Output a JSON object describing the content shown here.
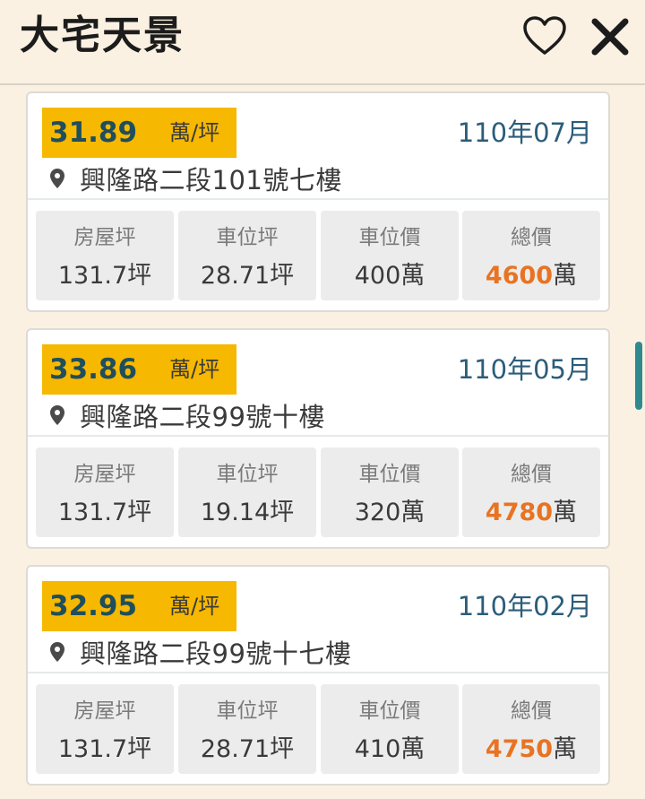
{
  "header": {
    "title": "大宅天景",
    "favorite_icon": "heart-outline-icon",
    "close_icon": "close-icon"
  },
  "colors": {
    "background": "#fbf1e2",
    "price_tag": "#f6b800",
    "price_text": "#1f4e5c",
    "date_text": "#2b5d7a",
    "total_price": "#e87322",
    "scrollbar": "#2f8a8f"
  },
  "transactions": [
    {
      "unit_price": "31.89",
      "unit_price_unit": "萬/坪",
      "date": "110年07月",
      "address": "興隆路二段101號七樓",
      "stats": [
        {
          "label": "房屋坪",
          "value": "131.7",
          "unit": "坪"
        },
        {
          "label": "車位坪",
          "value": "28.71",
          "unit": "坪"
        },
        {
          "label": "車位價",
          "value": "400",
          "unit": "萬"
        },
        {
          "label": "總價",
          "value": "4600",
          "unit": "萬"
        }
      ]
    },
    {
      "unit_price": "33.86",
      "unit_price_unit": "萬/坪",
      "date": "110年05月",
      "address": "興隆路二段99號十樓",
      "stats": [
        {
          "label": "房屋坪",
          "value": "131.7",
          "unit": "坪"
        },
        {
          "label": "車位坪",
          "value": "19.14",
          "unit": "坪"
        },
        {
          "label": "車位價",
          "value": "320",
          "unit": "萬"
        },
        {
          "label": "總價",
          "value": "4780",
          "unit": "萬"
        }
      ]
    },
    {
      "unit_price": "32.95",
      "unit_price_unit": "萬/坪",
      "date": "110年02月",
      "address": "興隆路二段99號十七樓",
      "stats": [
        {
          "label": "房屋坪",
          "value": "131.7",
          "unit": "坪"
        },
        {
          "label": "車位坪",
          "value": "28.71",
          "unit": "坪"
        },
        {
          "label": "車位價",
          "value": "410",
          "unit": "萬"
        },
        {
          "label": "總價",
          "value": "4750",
          "unit": "萬"
        }
      ]
    }
  ]
}
